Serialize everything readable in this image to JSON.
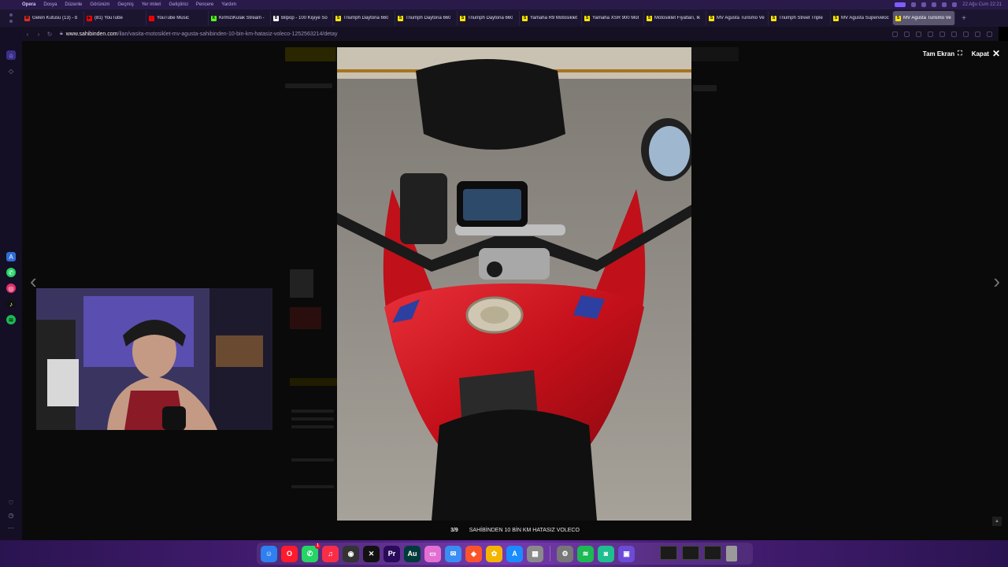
{
  "menubar": {
    "items": [
      "Opera",
      "Dosya",
      "Düzenle",
      "Görünüm",
      "Geçmiş",
      "Yer imleri",
      "Geliştirici",
      "Pencere",
      "Yardım"
    ],
    "clock": "22 Ağu Cum 22:21"
  },
  "tabs": [
    {
      "label": "Gelen Kutusu (13) - b",
      "favicon_color": "#d93025",
      "favicon": "M"
    },
    {
      "label": "(81) YouTube",
      "favicon_color": "#ff0000",
      "favicon": "▶"
    },
    {
      "label": "YouTube Music",
      "favicon_color": "#ff0000",
      "favicon": "♪"
    },
    {
      "label": "KirmiziKulak Stream -",
      "favicon_color": "#53fc18",
      "favicon": "K"
    },
    {
      "label": "Bilpop - 100 Kişiye So",
      "favicon_color": "#ffffff",
      "favicon": "B"
    },
    {
      "label": "Triumph Daytona 660",
      "favicon_color": "#ffe800",
      "favicon": "S"
    },
    {
      "label": "Triumph Daytona 660",
      "favicon_color": "#ffe800",
      "favicon": "S"
    },
    {
      "label": "Triumph Daytona 660",
      "favicon_color": "#ffe800",
      "favicon": "S"
    },
    {
      "label": "Yamaha R9 Motosiklet",
      "favicon_color": "#ffe800",
      "favicon": "S"
    },
    {
      "label": "Yamaha XSR 900 Mot",
      "favicon_color": "#ffe800",
      "favicon": "S"
    },
    {
      "label": "Motosiklet Fiyatları, İk",
      "favicon_color": "#ffe800",
      "favicon": "S"
    },
    {
      "label": "MV Agusta Turismo Ve",
      "favicon_color": "#ffe800",
      "favicon": "S"
    },
    {
      "label": "Triumph Street Triple",
      "favicon_color": "#ffe800",
      "favicon": "S"
    },
    {
      "label": "MV Agusta Superveloc",
      "favicon_color": "#ffe800",
      "favicon": "S"
    },
    {
      "label": "MV Agusta Turismo Ve",
      "favicon_color": "#ffe800",
      "favicon": "S",
      "active": true
    }
  ],
  "address": {
    "host": "www.sahibinden.com",
    "path": "/ilan/vasita-motosiklet-mv-agusta-sahibinden-10-bin-km-hatasiz-voleco-1252563214/detay"
  },
  "lightbox": {
    "fullscreen_label": "Tam Ekran",
    "close_label": "Kapat",
    "counter": "3/9",
    "title": "SAHİBİNDEN 10 BİN KM HATASIZ VOLECO",
    "prev_icon": "‹",
    "next_icon": "›"
  },
  "colors": {
    "bike_red": "#d0141e",
    "sidebar_accent": "#6f5cff"
  },
  "dock": [
    {
      "name": "finder",
      "color": "#2f7ff0",
      "glyph": "☺"
    },
    {
      "name": "opera",
      "color": "#ff1b2d",
      "glyph": "O"
    },
    {
      "name": "whatsapp",
      "color": "#25d366",
      "glyph": "✆",
      "badge": "1"
    },
    {
      "name": "music",
      "color": "#fa2d48",
      "glyph": "♫"
    },
    {
      "name": "obs",
      "color": "#333333",
      "glyph": "◉"
    },
    {
      "name": "capcut",
      "color": "#111111",
      "glyph": "✕"
    },
    {
      "name": "premiere",
      "color": "#2a0a5a",
      "glyph": "Pr"
    },
    {
      "name": "audition",
      "color": "#003a3a",
      "glyph": "Au"
    },
    {
      "name": "app-pink",
      "color": "#e46fd3",
      "glyph": "▭"
    },
    {
      "name": "mail",
      "color": "#3a8df5",
      "glyph": "✉"
    },
    {
      "name": "brave",
      "color": "#fb542b",
      "glyph": "◆"
    },
    {
      "name": "photos",
      "color": "#f5b400",
      "glyph": "✿"
    },
    {
      "name": "app-store",
      "color": "#1a8cff",
      "glyph": "A"
    },
    {
      "name": "launchpad",
      "color": "#8a8a8a",
      "glyph": "▦"
    },
    {
      "name": "settings",
      "color": "#777777",
      "glyph": "⚙"
    },
    {
      "name": "spotify",
      "color": "#1db954",
      "glyph": "≋"
    },
    {
      "name": "app-teal",
      "color": "#1fbf8f",
      "glyph": "◙"
    },
    {
      "name": "app-purple",
      "color": "#6b4bd8",
      "glyph": "▣"
    }
  ]
}
